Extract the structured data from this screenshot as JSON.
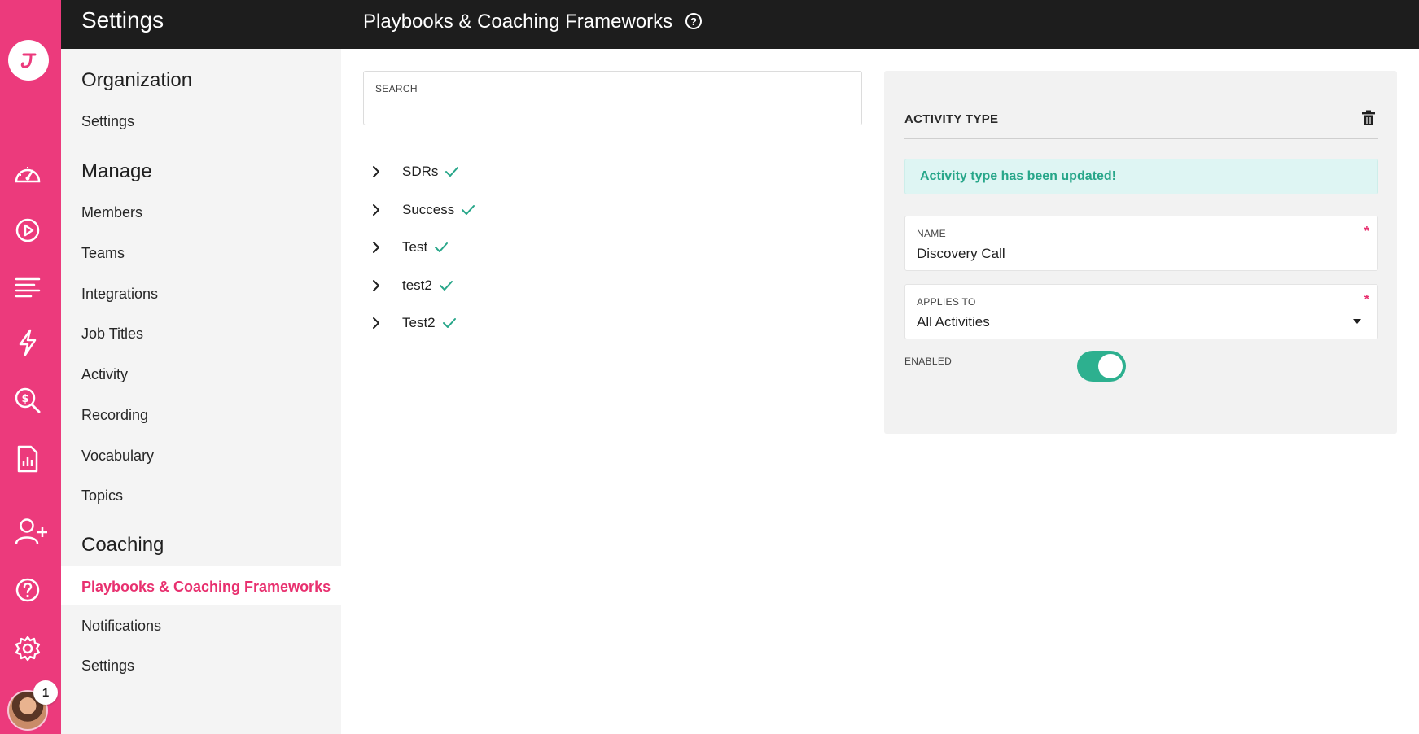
{
  "topbar": {
    "app_title": "Settings",
    "page_title": "Playbooks & Coaching Frameworks",
    "help_glyph": "?"
  },
  "rail": {
    "icons": [
      "logo-icon",
      "dashboard-icon",
      "play-icon",
      "list-icon",
      "bolt-icon",
      "deal-search-icon",
      "report-icon",
      "add-user-icon",
      "help-icon",
      "gear-icon"
    ],
    "notification_count": "1",
    "accent_color": "#ec3a7c"
  },
  "sidebar": {
    "organization": {
      "heading": "Organization",
      "items": [
        "Settings"
      ]
    },
    "manage": {
      "heading": "Manage",
      "items": [
        "Members",
        "Teams",
        "Integrations",
        "Job Titles",
        "Activity",
        "Recording",
        "Vocabulary",
        "Topics"
      ]
    },
    "coaching": {
      "heading": "Coaching",
      "items": [
        "Playbooks & Coaching Frameworks",
        "Notifications",
        "Settings"
      ],
      "active_index": 0
    }
  },
  "search": {
    "label": "SEARCH",
    "value": ""
  },
  "tree": {
    "items": [
      {
        "name": "SDRs",
        "checked": true
      },
      {
        "name": "Success",
        "checked": true
      },
      {
        "name": "Test",
        "checked": true
      },
      {
        "name": "test2",
        "checked": true
      },
      {
        "name": "Test2",
        "checked": true
      }
    ]
  },
  "panel": {
    "title": "ACTIVITY TYPE",
    "toast": "Activity type has been updated!",
    "name_field": {
      "label": "NAME",
      "value": "Discovery Call",
      "required_mark": "*"
    },
    "applies_field": {
      "label": "APPLIES TO",
      "value": "All Activities",
      "required_mark": "*"
    },
    "enabled_label": "ENABLED",
    "enabled": true
  },
  "colors": {
    "brand_pink": "#e8306f",
    "success_green": "#27a689",
    "toggle_on": "#2db08f"
  }
}
